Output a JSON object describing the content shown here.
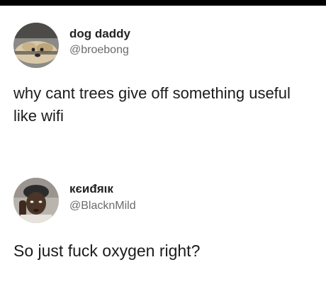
{
  "tweets": [
    {
      "display_name": "dog daddy",
      "handle": "@broebong",
      "text": "why cant trees give off something useful like wifi",
      "avatar_icon": "dog-photo-avatar"
    },
    {
      "display_name": "кєиđяιк",
      "handle": "@BlacknMild",
      "text": "So just fuck oxygen right?",
      "avatar_icon": "person-photo-avatar"
    }
  ]
}
